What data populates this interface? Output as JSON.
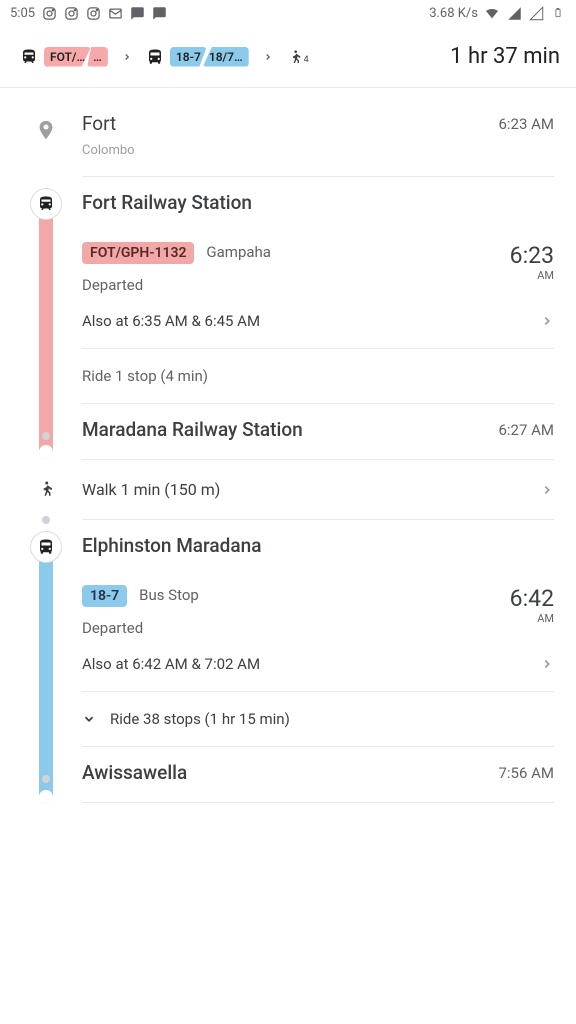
{
  "status": {
    "time": "5:05",
    "rate": "3.68 K/s"
  },
  "header": {
    "train_chip1": "FOT/…",
    "train_chip2": "…",
    "bus_chip1": "18-7",
    "bus_chip2": "18/7…",
    "walk_count": "4",
    "total": "1 hr 37 min"
  },
  "origin": {
    "name": "Fort",
    "sub": "Colombo",
    "time": "6:23 AM"
  },
  "train": {
    "station": "Fort Railway Station",
    "route": "FOT/GPH-1132",
    "dest": "Gampaha",
    "status": "Departed",
    "time": "6:23",
    "ampm": "AM",
    "also": "Also at 6:35 AM & 6:45 AM",
    "ride": "Ride 1 stop (4 min)",
    "alight_station": "Maradana Railway Station",
    "alight_time": "6:27 AM"
  },
  "walk": {
    "text": "Walk 1 min (150 m)"
  },
  "bus": {
    "station": "Elphinston Maradana",
    "route": "18-7",
    "dest": "Bus Stop",
    "status": "Departed",
    "time": "6:42",
    "ampm": "AM",
    "also": "Also at 6:42 AM & 7:02 AM",
    "ride": "Ride 38 stops (1 hr 15 min)",
    "alight_station": "Awissawella",
    "alight_time": "7:56 AM"
  }
}
